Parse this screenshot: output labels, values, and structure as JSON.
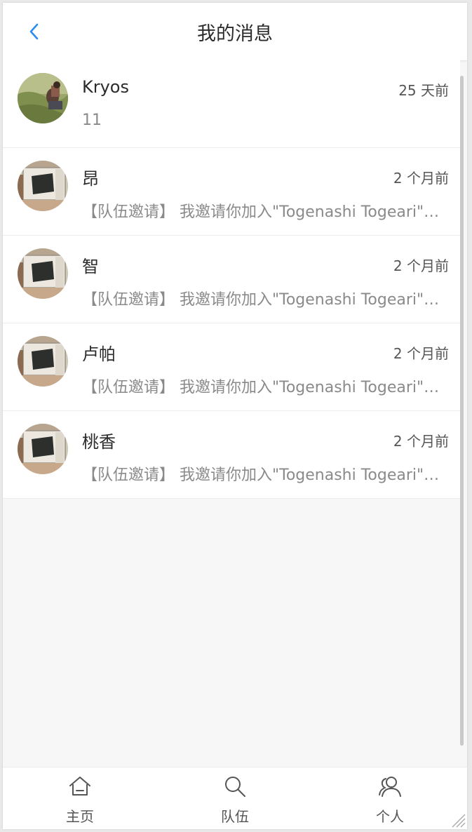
{
  "header": {
    "title": "我的消息",
    "back_icon": "chevron-left-icon",
    "accent_color": "#2d8cf0"
  },
  "messages": [
    {
      "name": "Kryos",
      "time": "25 天前",
      "preview": "11",
      "avatar": "avatar-field-photo"
    },
    {
      "name": "昂",
      "time": "2 个月前",
      "preview": "【队伍邀请】 我邀请你加入\"Togenashi Togeari\"队伍",
      "avatar": "avatar-car-photo"
    },
    {
      "name": "智",
      "time": "2 个月前",
      "preview": "【队伍邀请】 我邀请你加入\"Togenashi Togeari\"队伍",
      "avatar": "avatar-car-photo"
    },
    {
      "name": "卢帕",
      "time": "2 个月前",
      "preview": "【队伍邀请】 我邀请你加入\"Togenashi Togeari\"队伍",
      "avatar": "avatar-car-photo"
    },
    {
      "name": "桃香",
      "time": "2 个月前",
      "preview": "【队伍邀请】 我邀请你加入\"Togenashi Togeari\"队伍",
      "avatar": "avatar-car-photo"
    }
  ],
  "tabbar": {
    "home": {
      "label": "主页",
      "icon": "home-icon"
    },
    "team": {
      "label": "队伍",
      "icon": "search-icon"
    },
    "profile": {
      "label": "个人",
      "icon": "users-icon"
    }
  }
}
